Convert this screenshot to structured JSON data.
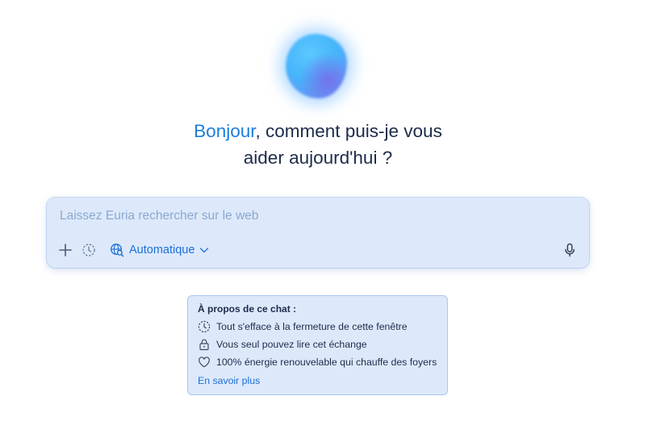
{
  "hero": {
    "greeting_highlight": "Bonjour",
    "greeting_rest_line1": ", comment puis-je vous",
    "greeting_line2": "aider aujourd'hui ?"
  },
  "prompt": {
    "placeholder": "Laissez Euria rechercher sur le web",
    "value": "",
    "mode_label": "Automatique",
    "tools": {
      "add_icon": "plus-icon",
      "ephemeral_icon": "clock-dashed-icon",
      "mode_icon": "globe-search-icon",
      "mode_chevron_icon": "chevron-down-icon",
      "mic_icon": "microphone-icon"
    }
  },
  "info": {
    "title": "À propos de ce chat :",
    "items": [
      {
        "icon": "clock-dashed-icon",
        "text": "Tout s'efface à la fermeture de cette fenêtre"
      },
      {
        "icon": "lock-icon",
        "text": "Vous seul pouvez lire cet échange"
      },
      {
        "icon": "heart-icon",
        "text": "100% énergie renouvelable qui chauffe des foyers"
      }
    ],
    "link_label": "En savoir plus"
  },
  "colors": {
    "accent": "#1b7de0",
    "text": "#1d2b4a",
    "panel": "#dde9fb"
  }
}
